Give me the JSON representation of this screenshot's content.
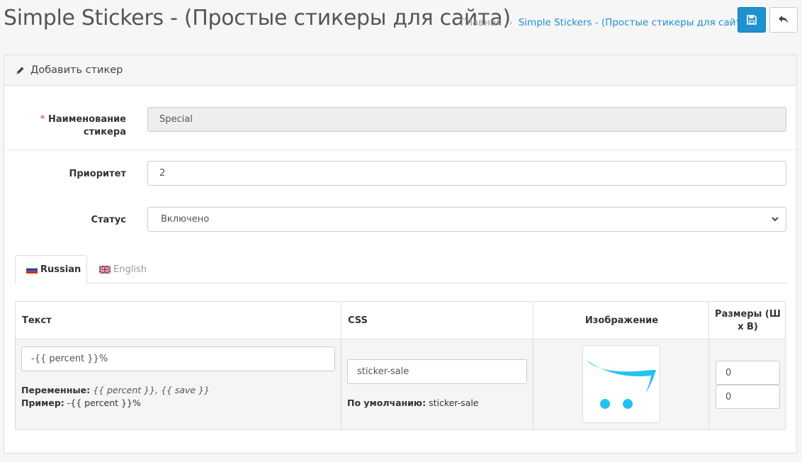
{
  "header": {
    "title": "Simple Stickers - (Простые стикеры для сайта)",
    "breadcrumb": [
      "Главная",
      "Simple Stickers - (Простые стикеры для сайта)"
    ],
    "breadcrumb_separator": "›"
  },
  "toolbar": {
    "save_icon": "save-icon",
    "back_icon": "reply-icon",
    "accent": "#1e91cf"
  },
  "panel": {
    "title": "Добавить стикер",
    "icon": "pencil-icon"
  },
  "form": {
    "name": {
      "required_mark": "*",
      "label_line1": "Наименование",
      "label_line2": "стикера",
      "value": "Special"
    },
    "priority": {
      "label": "Приоритет",
      "value": "2"
    },
    "status": {
      "label": "Статус",
      "value": "Включено"
    }
  },
  "tabs": [
    {
      "label": "Russian",
      "active": true
    },
    {
      "label": "English",
      "active": false
    }
  ],
  "table": {
    "headers": {
      "text": "Текст",
      "css": "CSS",
      "image": "Изображение",
      "size_line1": "Размеры (Ш",
      "size_line2": "х В)"
    },
    "row": {
      "text_value": "-{{ percent }}%",
      "vars_label": "Переменные:",
      "vars_value": "{{ percent }}, {{ save }}",
      "example_label": "Пример:",
      "example_value": "-{{ percent }}%",
      "css_value": "sticker-sale",
      "css_default_label": "По умолчанию:",
      "css_default_value": "sticker-sale",
      "width": "0",
      "height": "0"
    }
  }
}
